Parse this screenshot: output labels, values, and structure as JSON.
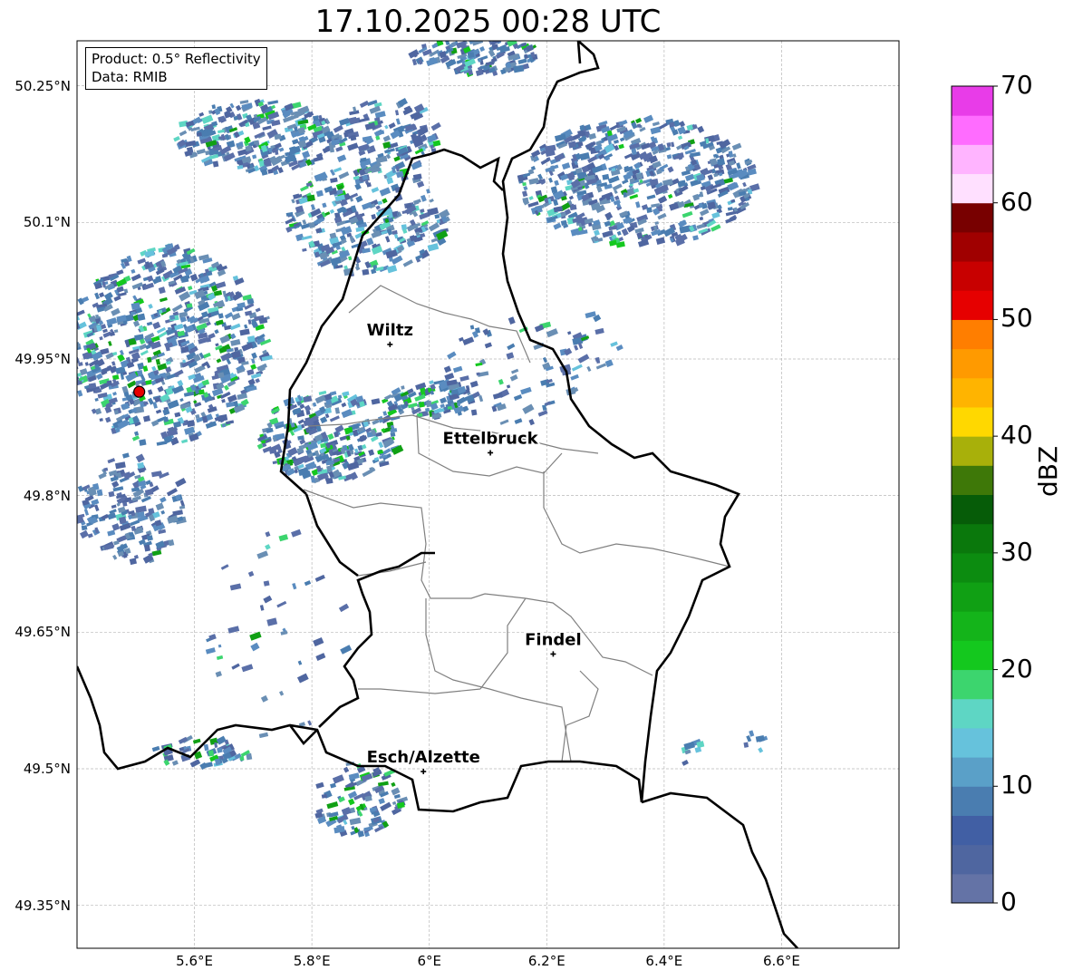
{
  "title": "17.10.2025 00:28 UTC",
  "info": {
    "product": "Product: 0.5° Reflectivity",
    "data": "Data: RMIB"
  },
  "map_data": {
    "type": "radar-reflectivity",
    "lon_range": [
      5.4,
      6.8
    ],
    "lat_range": [
      49.31,
      50.3
    ],
    "radar_site": {
      "lon": 5.506,
      "lat": 49.914
    },
    "lat_ticks": [
      "50.25°N",
      "50.1°N",
      "49.95°N",
      "49.8°N",
      "49.65°N",
      "49.5°N",
      "49.35°N"
    ],
    "lat_values": [
      50.25,
      50.1,
      49.95,
      49.8,
      49.65,
      49.5,
      49.35
    ],
    "lon_ticks": [
      "5.6°E",
      "5.8°E",
      "6°E",
      "6.2°E",
      "6.4°E",
      "6.6°E"
    ],
    "lon_values": [
      5.6,
      5.8,
      6.0,
      6.2,
      6.4,
      6.6
    ],
    "cities": [
      {
        "name": "Wiltz",
        "lon": 5.933,
        "lat": 49.966
      },
      {
        "name": "Ettelbruck",
        "lon": 6.104,
        "lat": 49.847
      },
      {
        "name": "Findel",
        "lon": 6.211,
        "lat": 49.626
      },
      {
        "name": "Esch/Alzette",
        "lon": 5.99,
        "lat": 49.497
      }
    ],
    "grid": true
  },
  "colorbar": {
    "label": "dBZ",
    "ticks": [
      "0",
      "10",
      "20",
      "30",
      "40",
      "50",
      "60",
      "70"
    ],
    "min": 0,
    "max": 70,
    "step": 2.5,
    "colors": [
      "#6473a6",
      "#4f66a0",
      "#415fa4",
      "#4a7db0",
      "#5aa0c8",
      "#66c2dc",
      "#5ed6c4",
      "#3cd56e",
      "#14c81e",
      "#14b41a",
      "#10a014",
      "#0c8c10",
      "#0a780c",
      "#065c08",
      "#3e7808",
      "#a8b00a",
      "#ffd800",
      "#ffb400",
      "#ff9a00",
      "#ff7e00",
      "#e60000",
      "#c80000",
      "#a00000",
      "#780000",
      "#ffe0ff",
      "#ffb4ff",
      "#ff6cff",
      "#e83ce8"
    ]
  }
}
